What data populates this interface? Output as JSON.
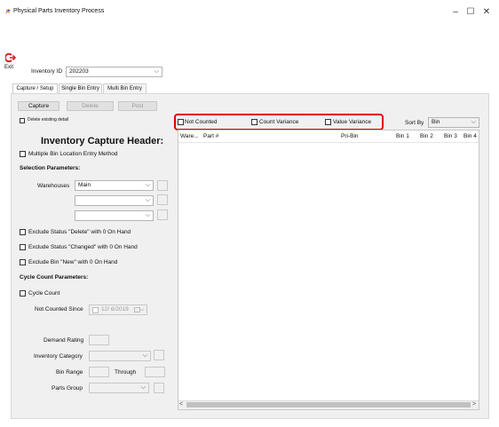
{
  "window": {
    "title": "Physical Parts Inventory Process",
    "minimize": "–",
    "maximize": "☐",
    "close": "✕"
  },
  "toolbar": {
    "exit_label": "Exit"
  },
  "inventory_id": {
    "label": "Inventory ID",
    "value": "202203"
  },
  "tabs": [
    {
      "label": "Capture / Setup",
      "active": true
    },
    {
      "label": "Single Bin Entry",
      "active": false
    },
    {
      "label": "Multi Bin Entry",
      "active": false
    }
  ],
  "buttons": {
    "capture": "Capture",
    "delete": "Delete",
    "post": "Post"
  },
  "delete_existing": "Delete existing detail",
  "header_title": "Inventory Capture Header:",
  "multiple_bin": "Multiple Bin Location Entry Method",
  "selection_params": "Selection Parameters:",
  "warehouses": {
    "label": "Warehouses",
    "value": "Main"
  },
  "exclusions": [
    "Exclude Status \"Delete\" with 0 On Hand",
    "Exclude Status \"Changed\" with 0 On Hand",
    "Exclude Bin \"New\" with 0 On Hand"
  ],
  "cycle_params": "Cycle Count Parameters:",
  "cycle_count": "Cycle Count",
  "not_counted_since": {
    "label": "Not Counted Since",
    "value": "12/ 6/2019"
  },
  "demand_rating": "Demand Rating",
  "inventory_category": "Inventory Category",
  "bin_range": {
    "label": "Bin Range",
    "through": "Through"
  },
  "parts_group": "Parts Group",
  "filters": {
    "not_counted": "Not Counted",
    "count_variance": "Count Variance",
    "value_variance": "Value Variance"
  },
  "sort_by": {
    "label": "Sort By",
    "value": "Bin"
  },
  "grid_columns": [
    "Ware...",
    "Part #",
    "Pri-Bin",
    "Bin 1",
    "Bin 2",
    "Bin 3",
    "Bin 4"
  ],
  "scroll": {
    "left": "<",
    "right": ">"
  },
  "glyphs": {
    "dropdown": "⌵"
  },
  "colors": {
    "highlight": "#e00000",
    "exit_icon": "#e02020"
  }
}
